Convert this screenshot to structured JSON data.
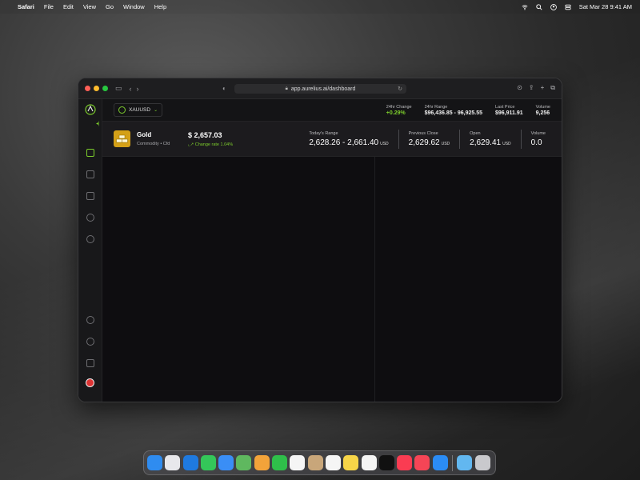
{
  "menubar": {
    "app": "Safari",
    "items": [
      "File",
      "Edit",
      "View",
      "Go",
      "Window",
      "Help"
    ],
    "datetime": "Sat Mar 28  9:41 AM"
  },
  "browser": {
    "url": "app.aurelius.ai/dashboard"
  },
  "topbar": {
    "symbol": "XAUUSD",
    "stats": [
      {
        "label": "24hr Change",
        "value": "+0.29%",
        "positive": true
      },
      {
        "label": "24hr Range",
        "value": "$96,436.85 - 96,925.55"
      },
      {
        "label": "Last Price",
        "value": "$96,911.91"
      },
      {
        "label": "Volume",
        "value": "9,256"
      }
    ]
  },
  "asset": {
    "name": "Gold",
    "subtitle": "Commodity  •  Cfd",
    "price": "$ 2,657.03",
    "change_rate": "Change rate 1.04%",
    "blocks": [
      {
        "label": "Today's Range",
        "value": "2,628.26 - 2,661.40",
        "unit": "USD"
      },
      {
        "label": "Previous Close",
        "value": "2,629.62",
        "unit": "USD"
      },
      {
        "label": "Open",
        "value": "2,629.41",
        "unit": "USD"
      },
      {
        "label": "Volume",
        "value": "0.0",
        "unit": ""
      }
    ]
  },
  "colors": {
    "accent": "#7ccc2c",
    "gold": "#d4a017"
  },
  "dock": {
    "apps": [
      {
        "name": "finder-icon",
        "color": "#2f8cf0"
      },
      {
        "name": "launchpad-icon",
        "color": "#e8e8ec"
      },
      {
        "name": "safari-icon",
        "color": "#1f7ae0"
      },
      {
        "name": "messages-icon",
        "color": "#34c759"
      },
      {
        "name": "mail-icon",
        "color": "#3a8ef6"
      },
      {
        "name": "maps-icon",
        "color": "#5fb85f"
      },
      {
        "name": "photos-icon",
        "color": "#f2a33a"
      },
      {
        "name": "facetime-icon",
        "color": "#2fbf4a"
      },
      {
        "name": "calendar-icon",
        "color": "#f5f5f5"
      },
      {
        "name": "contacts-icon",
        "color": "#c8a67a"
      },
      {
        "name": "reminders-icon",
        "color": "#f5f5f5"
      },
      {
        "name": "notes-icon",
        "color": "#f7d548"
      },
      {
        "name": "freeform-icon",
        "color": "#f5f5f5"
      },
      {
        "name": "tv-icon",
        "color": "#111111"
      },
      {
        "name": "music-icon",
        "color": "#fa3c52"
      },
      {
        "name": "news-icon",
        "color": "#f54556"
      },
      {
        "name": "app-store-icon",
        "color": "#2b8cf5"
      }
    ],
    "extras": [
      {
        "name": "downloads-folder-icon",
        "color": "#62b7f0"
      },
      {
        "name": "trash-icon",
        "color": "#c9c9cd"
      }
    ]
  }
}
